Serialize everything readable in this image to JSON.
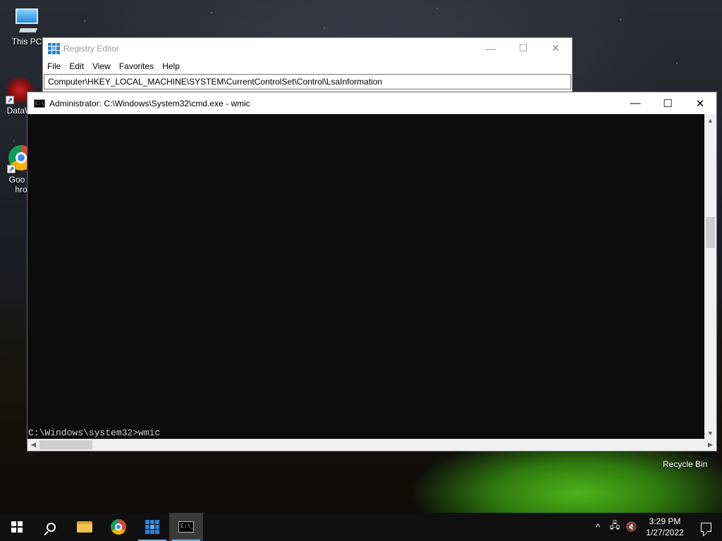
{
  "desktop": {
    "icons": [
      {
        "label": "This PC"
      },
      {
        "label": "DataW"
      },
      {
        "label": "Goo Chro"
      }
    ],
    "recycle_bin_label": "Recycle Bin"
  },
  "regedit": {
    "title": "Registry Editor",
    "menu": [
      "File",
      "Edit",
      "View",
      "Favorites",
      "Help"
    ],
    "address": "Computer\\HKEY_LOCAL_MACHINE\\SYSTEM\\CurrentControlSet\\Control\\LsaInformation",
    "caption": {
      "minimize": "—",
      "maximize": "☐",
      "close": "✕"
    }
  },
  "cmd": {
    "title": "Administrator: C:\\Windows\\System32\\cmd.exe - wmic",
    "icon_text": "C:\\_",
    "prompt_line": "C:\\Windows\\system32>wmic",
    "caption": {
      "minimize": "—",
      "maximize": "☐",
      "close": "✕"
    },
    "scroll": {
      "up": "▲",
      "down": "▼",
      "left": "◀",
      "right": "▶"
    }
  },
  "taskbar": {
    "apps": [
      "start",
      "search",
      "file-explorer",
      "chrome",
      "registry-editor",
      "command-prompt"
    ],
    "active_app": "command-prompt",
    "tray": {
      "chevron": "^",
      "network": "🖧",
      "volume": "🔇"
    },
    "clock": {
      "time": "3:29 PM",
      "date": "1/27/2022"
    },
    "cmd_icon_text": "C:\\_"
  }
}
